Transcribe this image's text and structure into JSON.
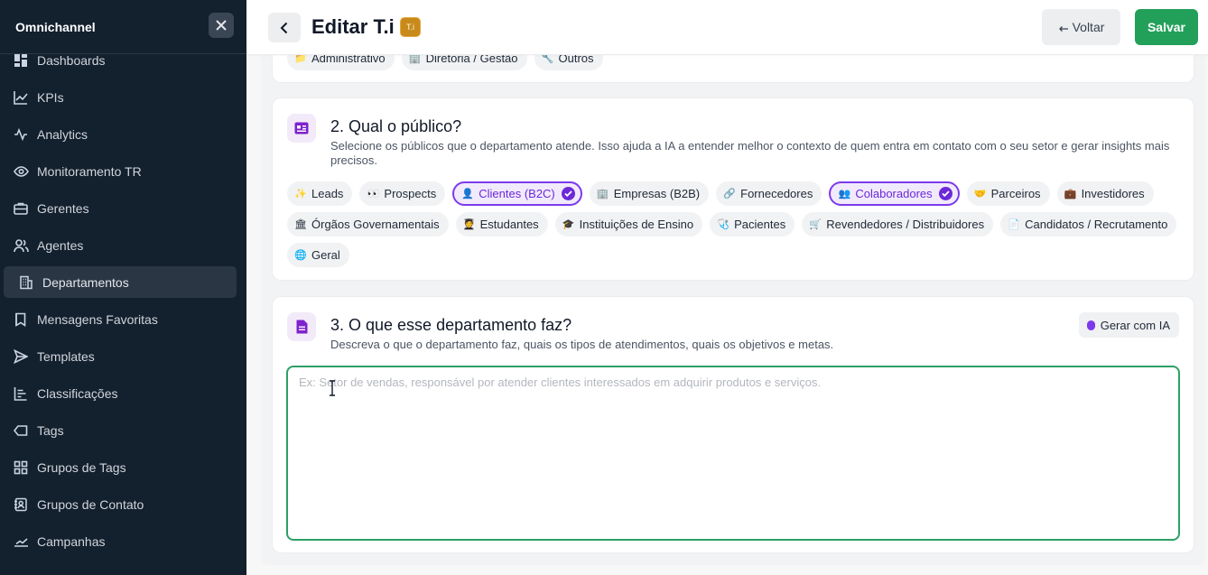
{
  "sidebar": {
    "brand": "Omnichannel",
    "items": [
      {
        "label": "Dashboards",
        "icon": "dashboard-icon"
      },
      {
        "label": "KPIs",
        "icon": "line-chart-icon"
      },
      {
        "label": "Analytics",
        "icon": "activity-icon"
      },
      {
        "label": "Monitoramento TR",
        "icon": "eye-icon"
      },
      {
        "label": "Gerentes",
        "icon": "briefcase-icon"
      },
      {
        "label": "Agentes",
        "icon": "users-icon"
      },
      {
        "label": "Departamentos",
        "icon": "building-icon",
        "active": true
      },
      {
        "label": "Mensagens Favoritas",
        "icon": "bookmark-icon"
      },
      {
        "label": "Templates",
        "icon": "send-icon"
      },
      {
        "label": "Classificações",
        "icon": "bars-icon"
      },
      {
        "label": "Tags",
        "icon": "tag-icon"
      },
      {
        "label": "Grupos de Tags",
        "icon": "grid-icon"
      },
      {
        "label": "Grupos de Contato",
        "icon": "contacts-icon"
      },
      {
        "label": "Campanhas",
        "icon": "megaphone-icon"
      }
    ]
  },
  "header": {
    "title": "Editar T.i",
    "badge": "T.i",
    "back_label": "Voltar",
    "save_label": "Salvar"
  },
  "section1": {
    "chips": [
      {
        "label": "Administrativo",
        "emoji": "📁"
      },
      {
        "label": "Diretoria / Gestão",
        "emoji": "🏢"
      },
      {
        "label": "Outros",
        "emoji": "🔧"
      }
    ]
  },
  "section2": {
    "title": "2. Qual o público?",
    "description": "Selecione os públicos que o departamento atende. Isso ajuda a IA a entender melhor o contexto de quem entra em contato com o seu setor e gerar insights mais precisos.",
    "rows": [
      [
        {
          "label": "Leads",
          "emoji": "✨"
        },
        {
          "label": "Prospects",
          "emoji": "👀"
        },
        {
          "label": "Clientes (B2C)",
          "emoji": "👤",
          "selected": true
        },
        {
          "label": "Empresas (B2B)",
          "emoji": "🏢"
        },
        {
          "label": "Fornecedores",
          "emoji": "🔗"
        },
        {
          "label": "Colaboradores",
          "emoji": "👥",
          "selected": true
        },
        {
          "label": "Parceiros",
          "emoji": "🤝"
        },
        {
          "label": "Investidores",
          "emoji": "💼"
        }
      ],
      [
        {
          "label": "Órgãos Governamentais",
          "emoji": "🏛"
        },
        {
          "label": "Estudantes",
          "emoji": "🧑‍🎓"
        },
        {
          "label": "Instituições de Ensino",
          "emoji": "🎓"
        },
        {
          "label": "Pacientes",
          "emoji": "🩺"
        },
        {
          "label": "Revendedores / Distribuidores",
          "emoji": "🛒"
        },
        {
          "label": "Candidatos / Recrutamento",
          "emoji": "📄"
        }
      ],
      [
        {
          "label": "Geral",
          "emoji": "🌐"
        }
      ]
    ]
  },
  "section3": {
    "title": "3. O que esse departamento faz?",
    "description": "Descreva o que o departamento faz, quais os tipos de atendimentos, quais os objetivos e metas.",
    "ai_button": "Gerar com IA",
    "textarea_value": "",
    "textarea_placeholder": "Ex: Setor de vendas, responsável por atender clientes interessados em adquirir produtos e serviços."
  },
  "colors": {
    "sidebar_bg": "#13202e",
    "accent_purple": "#6d28d9",
    "success_green": "#22a05a",
    "badge_gold": "#c88a1a"
  }
}
